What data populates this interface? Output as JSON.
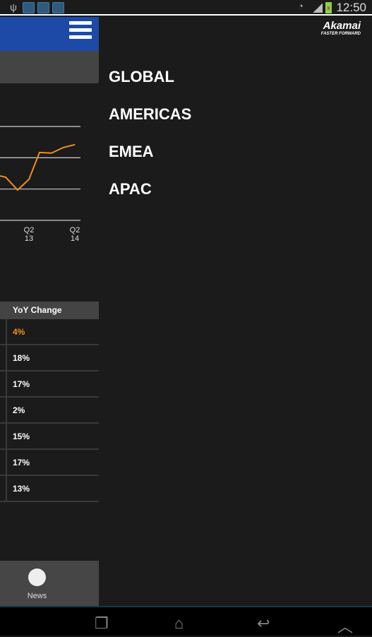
{
  "status_bar": {
    "time": "12:50",
    "icons": [
      "usb-icon",
      "chart-notification-icon",
      "chart-notification-icon",
      "chart-notification-icon",
      "wifi-icon",
      "signal-icon",
      "battery-icon"
    ]
  },
  "header": {
    "menu_icon": "hamburger-menu-icon",
    "accent": "#1c4aa6"
  },
  "chart_data": {
    "type": "line",
    "color": "#f0901e",
    "x_ticks": [
      {
        "q": "Q2",
        "y": "13"
      },
      {
        "q": "Q2",
        "y": "14"
      }
    ],
    "values": [
      1.42,
      1.38,
      0.97,
      1.31,
      2.17,
      2.15,
      2.33,
      2.42
    ],
    "grid": true,
    "ylim": [
      0,
      3
    ]
  },
  "table": {
    "header": "YoY Change",
    "rows": [
      "4%",
      "18%",
      "17%",
      "2%",
      "15%",
      "17%",
      "13%"
    ],
    "highlight_color": "#f0901e"
  },
  "bottom_nav": {
    "news_label": "News"
  },
  "drawer": {
    "logo": "Akamai",
    "logo_tagline": "FASTER FORWARD",
    "regions": [
      "GLOBAL",
      "AMERICAS",
      "EMEA",
      "APAC"
    ]
  }
}
